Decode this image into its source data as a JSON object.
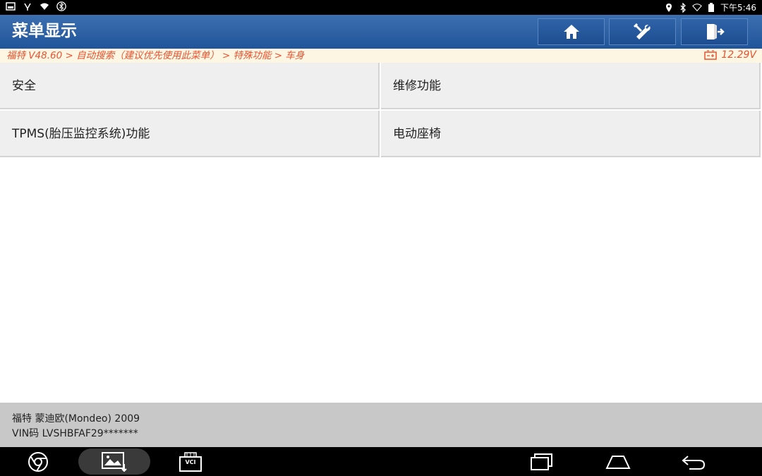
{
  "status_bar": {
    "time": "下午5:46"
  },
  "header": {
    "title": "菜单显示",
    "buttons": {
      "home": "home-icon",
      "tools": "tools-icon",
      "exit": "exit-icon"
    }
  },
  "breadcrumb": {
    "path": "福特 V48.60 > 自动搜索（建议优先使用此菜单） > 特殊功能 > 车身",
    "voltage": "12.29V"
  },
  "menu": {
    "items": [
      {
        "label": "安全"
      },
      {
        "label": "维修功能"
      },
      {
        "label": "TPMS(胎压监控系统)功能"
      },
      {
        "label": "电动座椅"
      }
    ]
  },
  "vehicle": {
    "model": "福特 蒙迪欧(Mondeo) 2009",
    "vin": "VIN码 LVSHBFAF29*******"
  },
  "nav": {
    "vci_label": "VCI"
  },
  "colors": {
    "header_blue": "#2c62a8",
    "crumb_text": "#e9532f",
    "crumb_bg": "#fdf6e3",
    "cell_bg": "#efefef",
    "footer_bg": "#c8c8c8"
  }
}
